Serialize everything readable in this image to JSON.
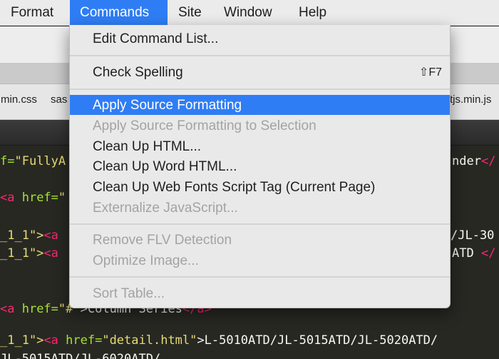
{
  "menubar": {
    "items": [
      "Format",
      "Commands",
      "Site",
      "Window",
      "Help"
    ],
    "active": "Commands"
  },
  "tabs": [
    "min.css",
    "sas",
    "tjs.min.js"
  ],
  "code": {
    "line1": {
      "a": "f=",
      "b": "\"FullyA",
      "c": "nder",
      "d": "</"
    },
    "line2": {
      "a": "<a ",
      "b": "href=",
      "c": "\""
    },
    "line3": {
      "a": "_1_1\">",
      "b": "<a",
      "c": "/JL-30"
    },
    "line4": {
      "a": "_1_1\">",
      "b": "<a",
      "c": "ATD ",
      "d": "</"
    },
    "line5": {
      "a": "<a ",
      "b": "href=",
      "c": "\"#\"",
      "d": ">Column Series",
      "e": "</a>"
    },
    "line6": {
      "a": "_1_1\">",
      "b": "<a ",
      "c": "href=",
      "d": "\"detail.html\"",
      "e": ">L-5010ATD/JL-5015ATD/JL-5020ATD/"
    },
    "line7": {
      "a": "JL-5015ATD/JL-6020ATD/"
    }
  },
  "menu": {
    "edit_command_list": "Edit Command List...",
    "check_spelling": "Check Spelling",
    "check_spelling_shortcut": "⇧F7",
    "apply_source_formatting": "Apply Source Formatting",
    "apply_source_formatting_selection": "Apply Source Formatting to Selection",
    "clean_up_html": "Clean Up HTML...",
    "clean_up_word_html": "Clean Up Word HTML...",
    "clean_up_web_fonts": "Clean Up Web Fonts Script Tag (Current Page)",
    "externalize_javascript": "Externalize JavaScript...",
    "remove_flv_detection": "Remove FLV Detection",
    "optimize_image": "Optimize Image...",
    "sort_table": "Sort Table..."
  },
  "colors": {
    "highlight": "#2f7df5",
    "code_background": "#272822",
    "tag": "#f92672",
    "attribute": "#a6e22e",
    "string": "#e6db74"
  }
}
